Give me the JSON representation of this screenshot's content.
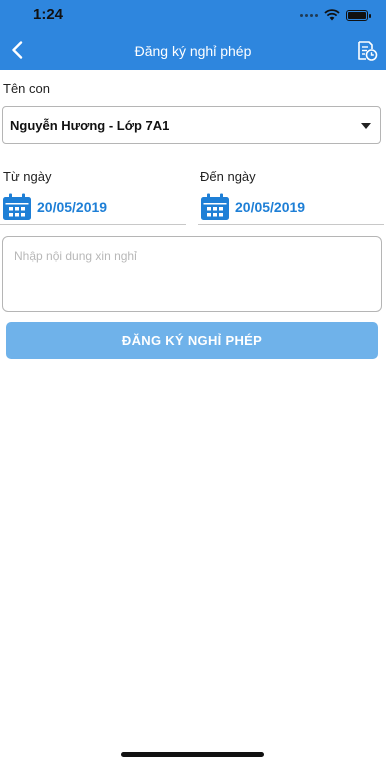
{
  "status_bar": {
    "time": "1:24"
  },
  "nav": {
    "title": "Đăng ký nghỉ phép",
    "back_icon": "chevron-left-icon",
    "history_icon": "document-clock-icon"
  },
  "form": {
    "child_label": "Tên con",
    "child_value": "Nguyễn Hương - Lớp 7A1",
    "from_label": "Từ ngày",
    "from_value": "20/05/2019",
    "to_label": "Đến ngày",
    "to_value": "20/05/2019",
    "reason_value": "",
    "reason_placeholder": "Nhập nội dung xin nghỉ",
    "submit_label": "ĐĂNG KÝ NGHỈ PHÉP"
  },
  "colors": {
    "header": "#2e86de",
    "accent": "#1e7fd6",
    "button": "#6fb2ea"
  }
}
